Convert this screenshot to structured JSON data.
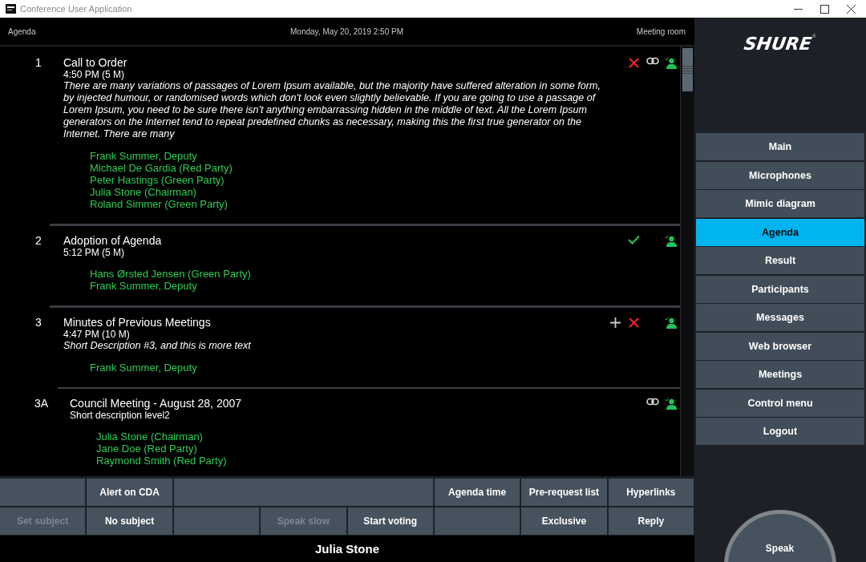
{
  "window": {
    "title": "Conference User Application"
  },
  "header": {
    "section": "Agenda",
    "datetime": "Monday, May 20, 2019 2:50 PM",
    "room": "Meeting room"
  },
  "agenda": [
    {
      "number": "1",
      "title": "Call to Order",
      "time": "4:50 PM (5 M)",
      "description": "There are many variations of passages of Lorem Ipsum available, but the majority have suffered alteration in some form, by injected humour, or randomised words which don't look even slightly believable. If you are going to use a passage of Lorem Ipsum, you need to be sure there isn't anything embarrassing hidden in the middle of text. All the Lorem Ipsum generators on the Internet tend to repeat predefined chunks as necessary, making this the first true generator on the Internet. There are many",
      "speakers": [
        "Frank Summer,  Deputy",
        "Michael De Gardia (Red Party)",
        "Peter Hastings (Green Party)",
        "Julia Stone (Chairman)",
        "Roland  Simmer (Green Party)"
      ],
      "icons": [
        {
          "kind": "remove"
        },
        {
          "kind": "link"
        },
        {
          "kind": "speakers"
        }
      ]
    },
    {
      "number": "2",
      "title": "Adoption of Agenda",
      "time": "5:12 PM (5 M)",
      "speakers": [
        "Hans Ørsted Jensen  (Green Party)",
        "Frank Summer,  Deputy"
      ],
      "icons": [
        {
          "kind": "done"
        },
        {
          "kind": "speakers"
        }
      ]
    },
    {
      "number": "3",
      "title": "Minutes of Previous Meetings",
      "time": "4:47 PM (10 M)",
      "description": "Short Description #3, and this is more text",
      "speakers": [
        "Frank Summer,  Deputy"
      ],
      "icons": [
        {
          "kind": "add"
        },
        {
          "kind": "remove"
        },
        {
          "kind": "speakers"
        }
      ],
      "children": [
        {
          "number": "3A",
          "title": "Council Meeting - August 28, 2007",
          "subtitle": "Short description level2",
          "speakers": [
            "Julia Stone (Chairman)",
            "Jane Doe  (Red Party)",
            "Raymond Smith (Red Party)"
          ],
          "icons": [
            {
              "kind": "link"
            },
            {
              "kind": "speakers"
            }
          ]
        }
      ]
    }
  ],
  "function_buttons": [
    [
      {
        "kind": "empty"
      },
      {
        "label": "Alert on CDA",
        "disabled": false
      },
      {
        "kind": "panel"
      },
      {
        "label": "Agenda time",
        "disabled": false
      },
      {
        "label": "Pre-request list",
        "disabled": false
      },
      {
        "label": "Hyperlinks",
        "disabled": false
      }
    ],
    [
      {
        "label": "Set subject",
        "disabled": true
      },
      {
        "label": "No subject",
        "disabled": false
      },
      {
        "kind": "empty"
      },
      {
        "label": "Speak slow",
        "disabled": true
      },
      {
        "label": "Start voting",
        "disabled": false
      },
      {
        "kind": "empty"
      },
      {
        "label": "Exclusive",
        "disabled": false
      },
      {
        "label": "Reply",
        "disabled": false
      }
    ]
  ],
  "status_bar": {
    "speaker": "Julia Stone"
  },
  "sidebar": {
    "logo": "SHURE",
    "logo_mark": "®",
    "items": [
      {
        "label": "Main",
        "selected": false
      },
      {
        "label": "Microphones",
        "selected": false
      },
      {
        "label": "Mimic diagram",
        "selected": false
      },
      {
        "label": "Agenda",
        "selected": true
      },
      {
        "label": "Result",
        "selected": false
      },
      {
        "label": "Participants",
        "selected": false
      },
      {
        "label": "Messages",
        "selected": false
      },
      {
        "label": "Web browser",
        "selected": false
      },
      {
        "label": "Meetings",
        "selected": false
      },
      {
        "label": "Control menu",
        "selected": false
      },
      {
        "label": "Logout",
        "selected": false
      }
    ],
    "speak_button": "Speak"
  }
}
